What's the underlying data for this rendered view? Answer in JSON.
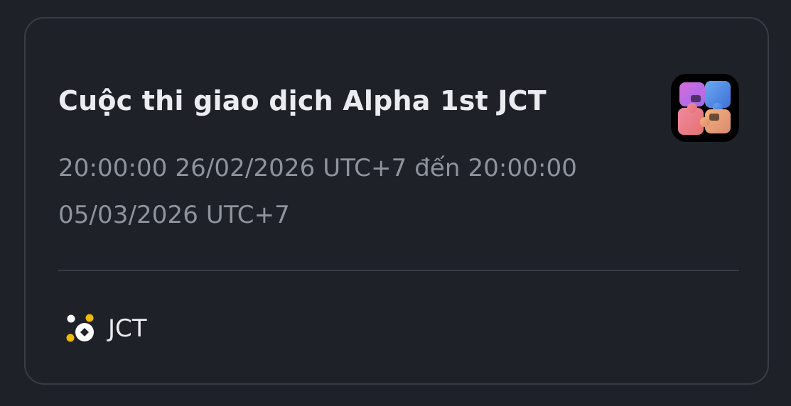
{
  "competition": {
    "title": "Cuộc thi giao dịch Alpha 1st JCT",
    "time_range": "20:00:00 26/02/2026 UTC+7 đến 20:00:00 05/03/2026 UTC+7",
    "logo_icon": "puzzle-logo-icon"
  },
  "token": {
    "icon": "alpha-token-icon",
    "symbol": "JCT"
  },
  "colors": {
    "background": "#1e2228",
    "card_border": "#383d46",
    "title_text": "#eaecef",
    "secondary_text": "#8e949d",
    "accent_yellow": "#f0b90b"
  }
}
